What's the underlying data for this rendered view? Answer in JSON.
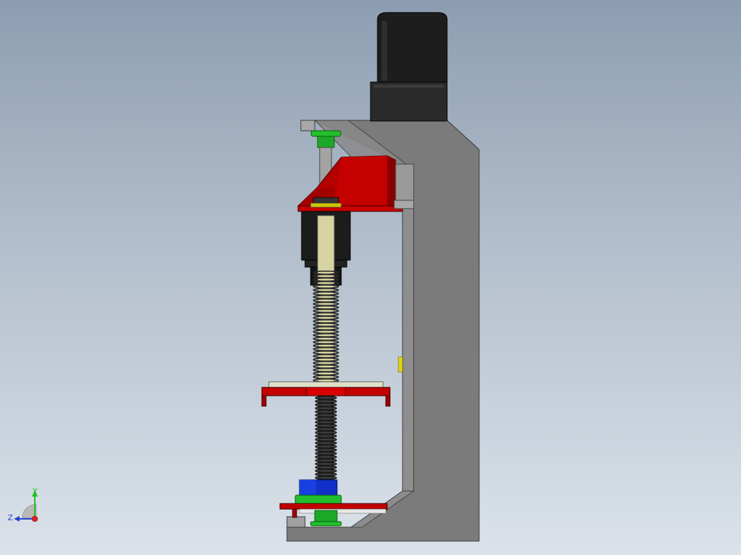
{
  "viewport": {
    "background_top": "#8d9db1",
    "background_bottom": "#dbe2ea"
  },
  "model": {
    "frame_color": "#7a7a7a",
    "frame_dark": "#555555",
    "motor_color": "#1e1e1e",
    "carriage_color": "#b30000",
    "bearing_color": "#1fbf2a",
    "rod_color": "#9a9a9a",
    "screw_color": "#d6d2a0",
    "block_color": "#1c1c1c",
    "blue_part_color": "#1030c8",
    "accent_yellow": "#e0d800"
  },
  "triad": {
    "y_label": "Y",
    "z_label": "Z",
    "y_color": "#20c020",
    "z_color": "#2040d0",
    "x_color": "#e02020"
  }
}
